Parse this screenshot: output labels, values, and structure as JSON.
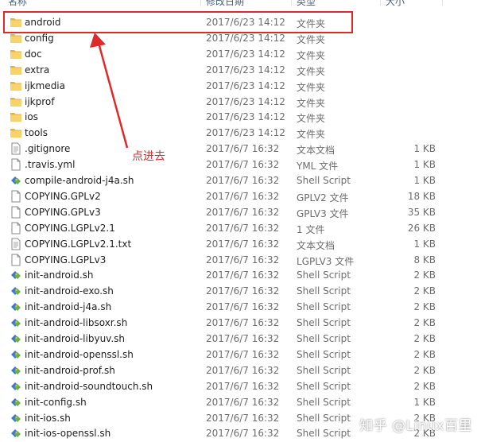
{
  "columns": {
    "name": "名称",
    "date": "修改日期",
    "type": "类型",
    "size": "大小"
  },
  "annotation": "点进去",
  "watermark": "知乎 @Linux百里",
  "accent": "#e02a2a",
  "files": [
    {
      "name": "android",
      "date": "2017/6/23 14:12",
      "type": "文件夹",
      "size": "",
      "icon": "folder-icon"
    },
    {
      "name": "config",
      "date": "2017/6/23 14:12",
      "type": "文件夹",
      "size": "",
      "icon": "folder-icon"
    },
    {
      "name": "doc",
      "date": "2017/6/23 14:12",
      "type": "文件夹",
      "size": "",
      "icon": "folder-icon"
    },
    {
      "name": "extra",
      "date": "2017/6/23 14:12",
      "type": "文件夹",
      "size": "",
      "icon": "folder-icon"
    },
    {
      "name": "ijkmedia",
      "date": "2017/6/23 14:12",
      "type": "文件夹",
      "size": "",
      "icon": "folder-icon"
    },
    {
      "name": "ijkprof",
      "date": "2017/6/23 14:12",
      "type": "文件夹",
      "size": "",
      "icon": "folder-icon"
    },
    {
      "name": "ios",
      "date": "2017/6/23 14:12",
      "type": "文件夹",
      "size": "",
      "icon": "folder-icon"
    },
    {
      "name": "tools",
      "date": "2017/6/23 14:12",
      "type": "文件夹",
      "size": "",
      "icon": "folder-icon"
    },
    {
      "name": ".gitignore",
      "date": "2017/6/7 16:32",
      "type": "文本文档",
      "size": "1 KB",
      "icon": "text-file-icon"
    },
    {
      "name": ".travis.yml",
      "date": "2017/6/7 16:32",
      "type": "YML 文件",
      "size": "1 KB",
      "icon": "file-icon"
    },
    {
      "name": "compile-android-j4a.sh",
      "date": "2017/6/7 16:32",
      "type": "Shell Script",
      "size": "1 KB",
      "icon": "script-icon"
    },
    {
      "name": "COPYING.GPLv2",
      "date": "2017/6/7 16:32",
      "type": "GPLV2 文件",
      "size": "18 KB",
      "icon": "file-icon"
    },
    {
      "name": "COPYING.GPLv3",
      "date": "2017/6/7 16:32",
      "type": "GPLV3 文件",
      "size": "35 KB",
      "icon": "file-icon"
    },
    {
      "name": "COPYING.LGPLv2.1",
      "date": "2017/6/7 16:32",
      "type": "1 文件",
      "size": "26 KB",
      "icon": "file-icon"
    },
    {
      "name": "COPYING.LGPLv2.1.txt",
      "date": "2017/6/7 16:32",
      "type": "文本文档",
      "size": "1 KB",
      "icon": "text-file-icon"
    },
    {
      "name": "COPYING.LGPLv3",
      "date": "2017/6/7 16:32",
      "type": "LGPLV3 文件",
      "size": "8 KB",
      "icon": "file-icon"
    },
    {
      "name": "init-android.sh",
      "date": "2017/6/7 16:32",
      "type": "Shell Script",
      "size": "2 KB",
      "icon": "script-icon"
    },
    {
      "name": "init-android-exo.sh",
      "date": "2017/6/7 16:32",
      "type": "Shell Script",
      "size": "2 KB",
      "icon": "script-icon"
    },
    {
      "name": "init-android-j4a.sh",
      "date": "2017/6/7 16:32",
      "type": "Shell Script",
      "size": "2 KB",
      "icon": "script-icon"
    },
    {
      "name": "init-android-libsoxr.sh",
      "date": "2017/6/7 16:32",
      "type": "Shell Script",
      "size": "2 KB",
      "icon": "script-icon"
    },
    {
      "name": "init-android-libyuv.sh",
      "date": "2017/6/7 16:32",
      "type": "Shell Script",
      "size": "2 KB",
      "icon": "script-icon"
    },
    {
      "name": "init-android-openssl.sh",
      "date": "2017/6/7 16:32",
      "type": "Shell Script",
      "size": "2 KB",
      "icon": "script-icon"
    },
    {
      "name": "init-android-prof.sh",
      "date": "2017/6/7 16:32",
      "type": "Shell Script",
      "size": "2 KB",
      "icon": "script-icon"
    },
    {
      "name": "init-android-soundtouch.sh",
      "date": "2017/6/7 16:32",
      "type": "Shell Script",
      "size": "2 KB",
      "icon": "script-icon"
    },
    {
      "name": "init-config.sh",
      "date": "2017/6/7 16:32",
      "type": "Shell Script",
      "size": "1 KB",
      "icon": "script-icon"
    },
    {
      "name": "init-ios.sh",
      "date": "2017/6/7 16:32",
      "type": "Shell Script",
      "size": "2 KB",
      "icon": "script-icon"
    },
    {
      "name": "init-ios-openssl.sh",
      "date": "2017/6/7 16:32",
      "type": "Shell Script",
      "size": "2 KB",
      "icon": "script-icon"
    }
  ]
}
